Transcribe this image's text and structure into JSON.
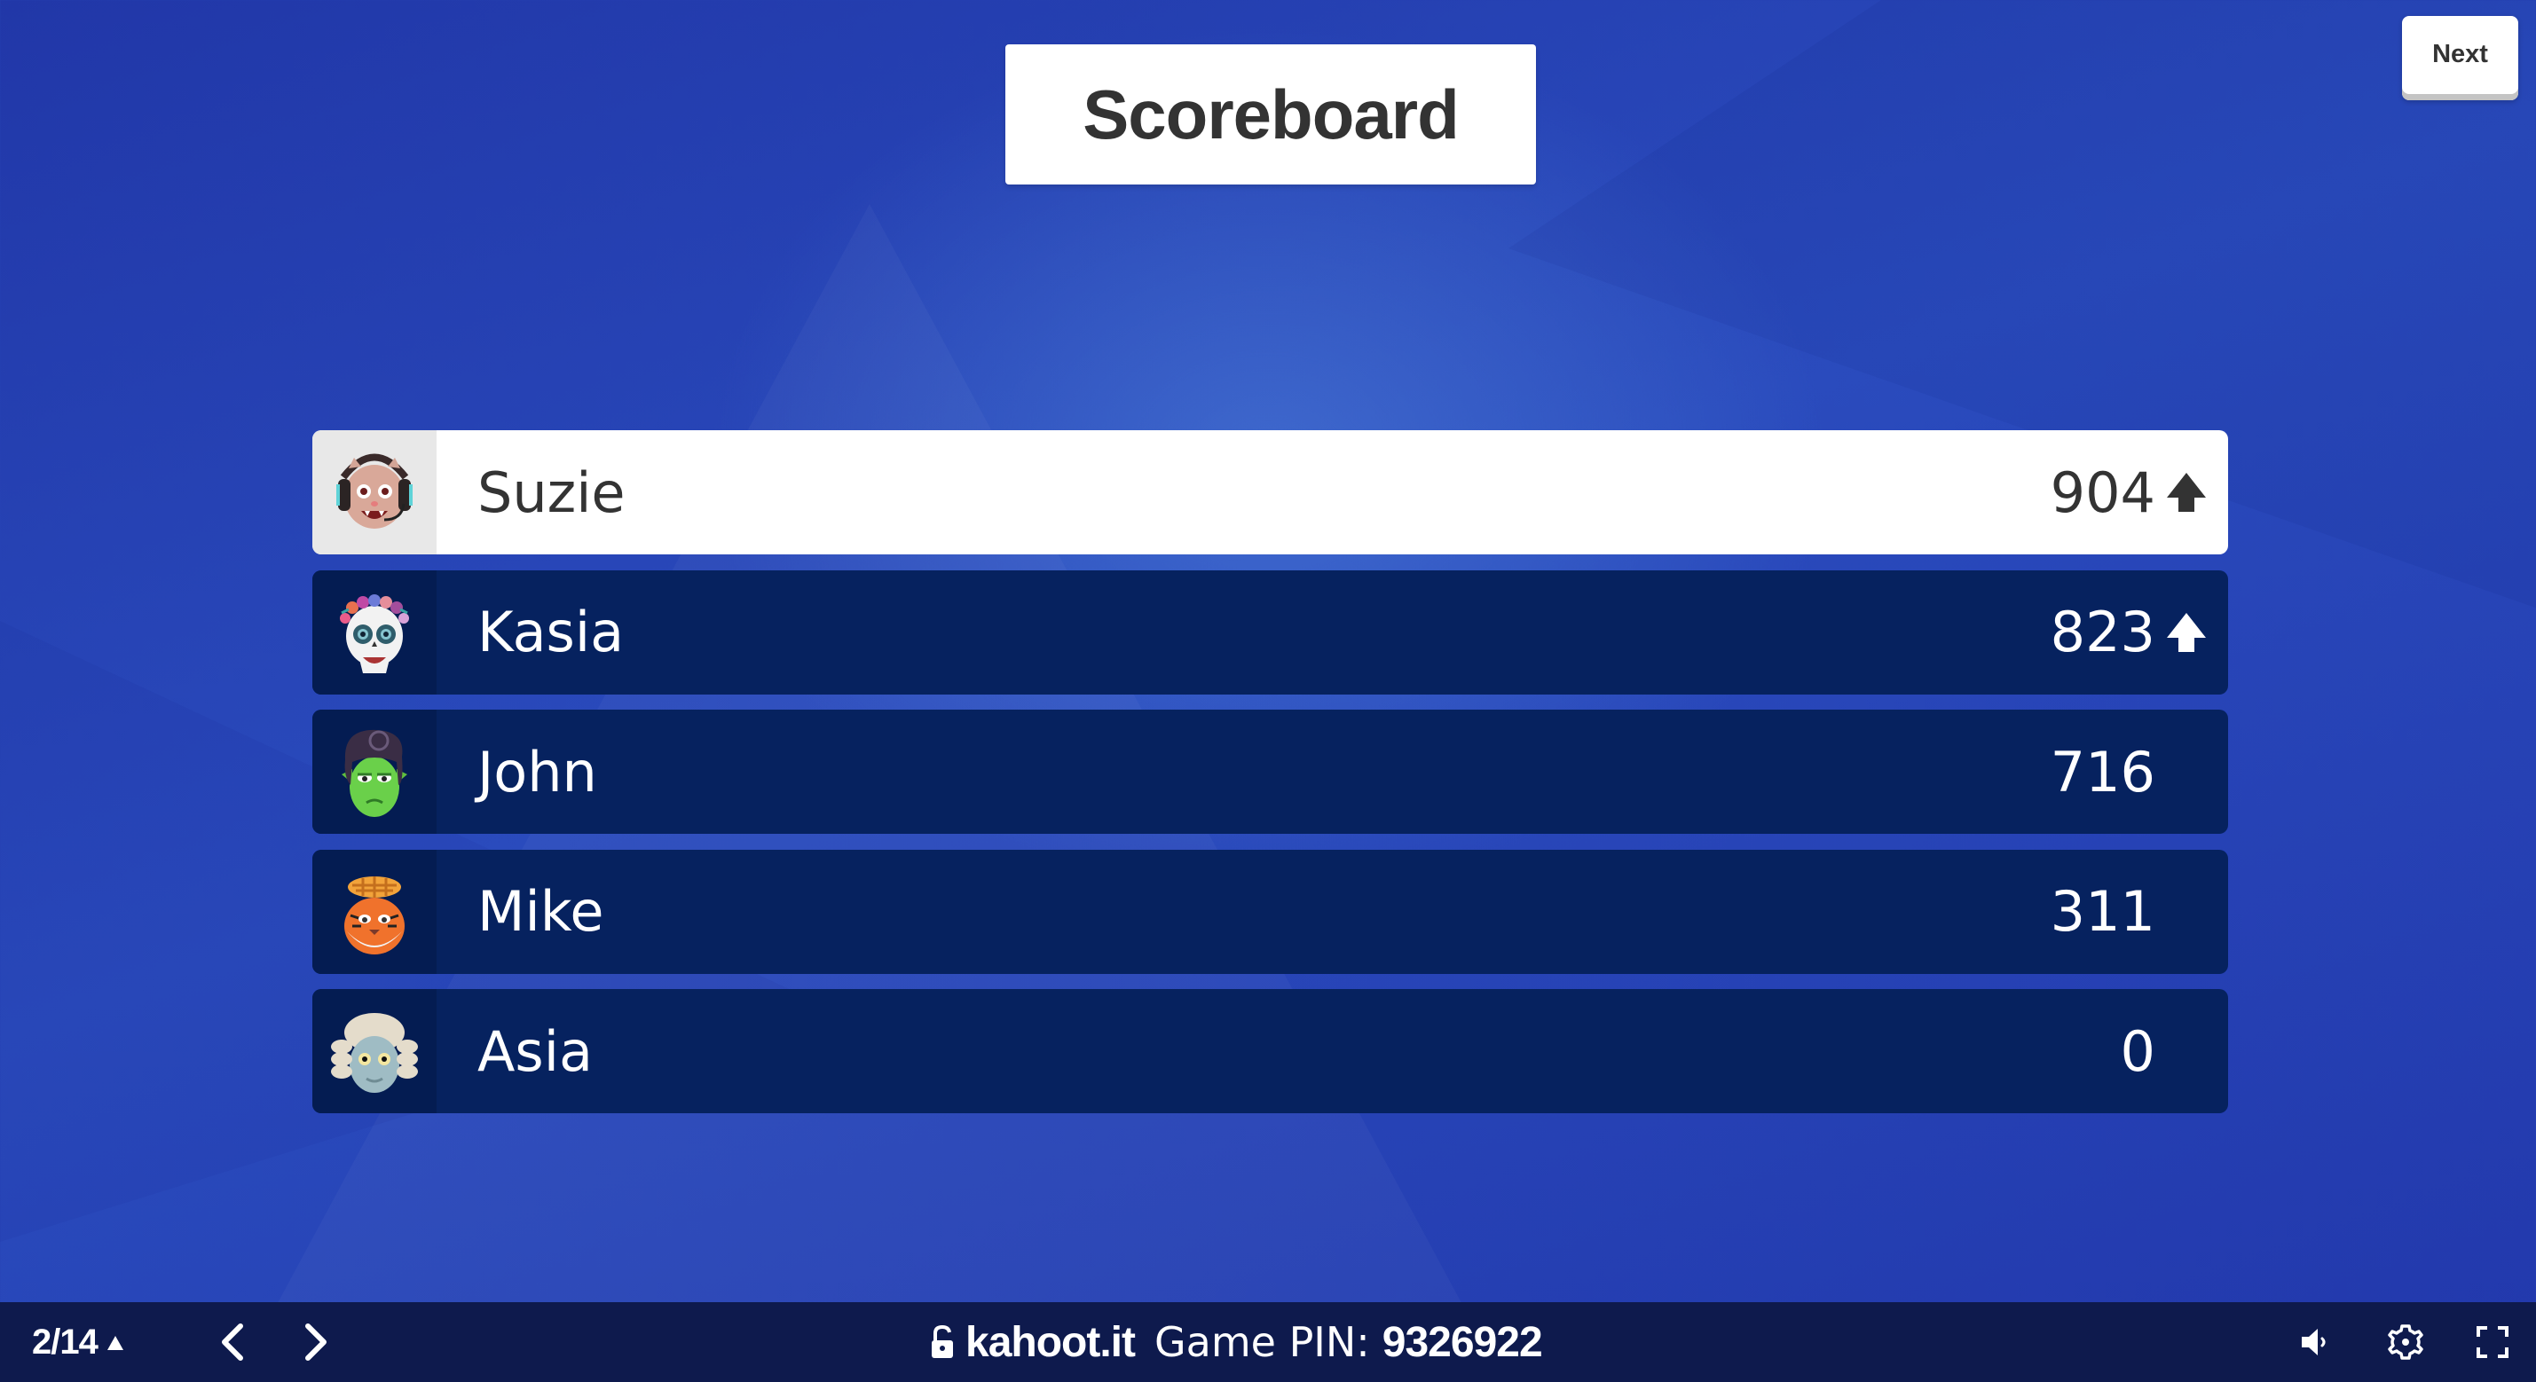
{
  "header": {
    "title": "Scoreboard",
    "next_label": "Next"
  },
  "scoreboard": [
    {
      "rank": 1,
      "name": "Suzie",
      "score": "904",
      "trend": "up",
      "avatar": "cat-gamer-headset-avatar",
      "highlighted": true
    },
    {
      "rank": 2,
      "name": "Kasia",
      "score": "823",
      "trend": "up",
      "avatar": "flower-crown-skull-avatar",
      "highlighted": false
    },
    {
      "rank": 3,
      "name": "John",
      "score": "716",
      "trend": "none",
      "avatar": "green-alien-pompadour-avatar",
      "highlighted": false
    },
    {
      "rank": 4,
      "name": "Mike",
      "score": "311",
      "trend": "none",
      "avatar": "tiger-pie-hat-avatar",
      "highlighted": false
    },
    {
      "rank": 5,
      "name": "Asia",
      "score": "0",
      "trend": "none",
      "avatar": "judge-wig-avatar",
      "highlighted": false
    }
  ],
  "bottom_bar": {
    "progress": "2/14",
    "progress_icon": "triangle-up-icon",
    "prev_icon": "chevron-left-icon",
    "next_icon": "chevron-right-icon",
    "lock_icon": "unlocked-padlock-icon",
    "url": "kahoot.it",
    "pin_label": "Game PIN:",
    "pin_value": "9326922",
    "sound_icon": "speaker-icon",
    "settings_icon": "gear-icon",
    "fullscreen_icon": "fullscreen-icon"
  },
  "colors": {
    "background": "#2440b4",
    "row_dark": "#06225f",
    "row_highlight": "#ffffff",
    "bottom_bar": "#0e1a4d",
    "text_dark": "#333333"
  }
}
